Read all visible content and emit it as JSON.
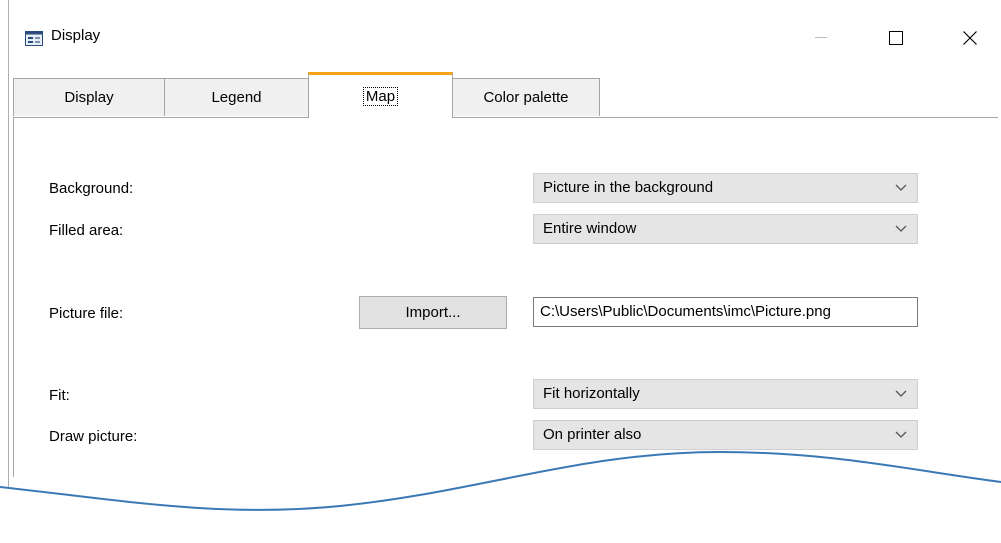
{
  "window": {
    "title": "Display",
    "icon": "window-settings-icon"
  },
  "title_controls": {
    "minimize": "minimize-icon",
    "maximize": "maximize-icon",
    "close": "close-icon"
  },
  "tabs": [
    {
      "label": "Display"
    },
    {
      "label": "Legend"
    },
    {
      "label": "Map",
      "active": true
    },
    {
      "label": "Color palette"
    }
  ],
  "form": {
    "background": {
      "label": "Background:",
      "value": "Picture in the background"
    },
    "filled_area": {
      "label": "Filled area:",
      "value": "Entire window"
    },
    "picture_file": {
      "label": "Picture file:",
      "button": "Import...",
      "value": "C:\\Users\\Public\\Documents\\imc\\Picture.png"
    },
    "fit": {
      "label": "Fit:",
      "value": "Fit horizontally"
    },
    "draw_picture": {
      "label": "Draw picture:",
      "value": "On printer also"
    }
  },
  "colors": {
    "active_tab_accent": "#f7a21b",
    "tear_line": "#3b79b5"
  }
}
